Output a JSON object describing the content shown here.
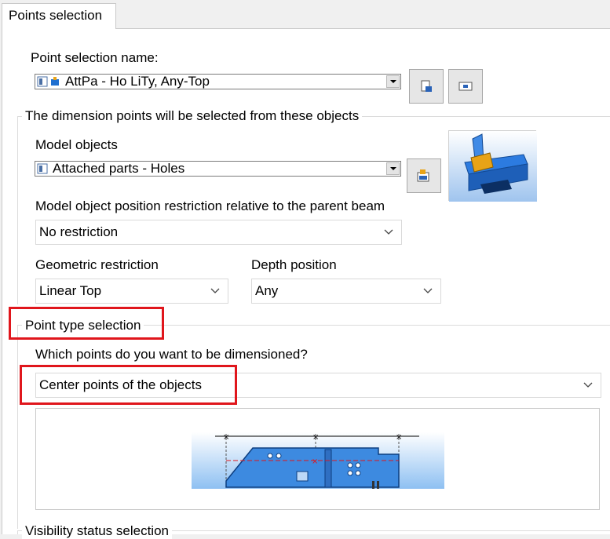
{
  "tab": {
    "label": "Points selection"
  },
  "point_selection": {
    "label": "Point selection name:",
    "value": "AttPa - Ho LiTy, Any-Top"
  },
  "objects_group": {
    "title": "The dimension points will be selected from these objects",
    "model_objects_label": "Model objects",
    "model_objects_value": "Attached parts - Holes",
    "restriction_label": "Model object position restriction relative to the parent beam",
    "restriction_value": "No restriction",
    "geometric_label": "Geometric restriction",
    "geometric_value": "Linear Top",
    "depth_label": "Depth position",
    "depth_value": "Any"
  },
  "point_type_group": {
    "title": "Point type selection",
    "question": "Which points do you want to be dimensioned?",
    "value": "Center points of the objects"
  },
  "visibility_group": {
    "title": "Visibility status selection"
  },
  "colors": {
    "highlight": "#e0161c",
    "accent_blue": "#1e6fd0"
  }
}
